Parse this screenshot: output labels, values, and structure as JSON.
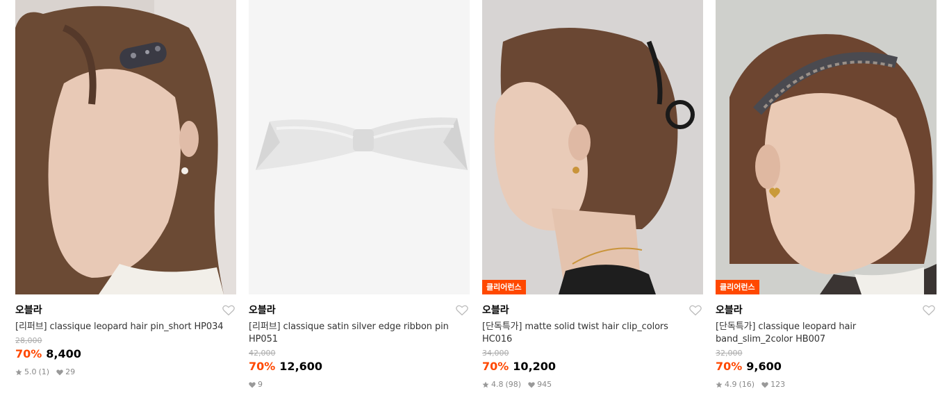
{
  "products": [
    {
      "brand": "오블라",
      "title": "[리퍼브] classique leopard hair pin_short HP034",
      "original_price": "28,000",
      "discount": "70%",
      "price": "8,400",
      "rating": "5.0",
      "review_count": "(1)",
      "likes": "29",
      "badge": null,
      "image_alt": "model wearing leopard hair pin"
    },
    {
      "brand": "오블라",
      "title": "[리퍼브] classique satin silver edge ribbon pin HP051",
      "original_price": "42,000",
      "discount": "70%",
      "price": "12,600",
      "rating": null,
      "review_count": null,
      "likes": "9",
      "badge": null,
      "image_alt": "white satin ribbon pin"
    },
    {
      "brand": "오블라",
      "title": "[단독특가] matte solid twist hair clip_colors HC016",
      "original_price": "34,000",
      "discount": "70%",
      "price": "10,200",
      "rating": "4.8",
      "review_count": "(98)",
      "likes": "945",
      "badge": "클리어런스",
      "image_alt": "model wearing black twist hair clip"
    },
    {
      "brand": "오블라",
      "title": "[단독특가] classique leopard hair band_slim_2color HB007",
      "original_price": "32,000",
      "discount": "70%",
      "price": "9,600",
      "rating": "4.9",
      "review_count": "(16)",
      "likes": "123",
      "badge": "클리어런스",
      "image_alt": "model wearing leopard hair band"
    }
  ],
  "colors": {
    "accent": "#ff4800",
    "muted": "#888888",
    "strike": "#aaaaaa"
  },
  "icons": {
    "like": "heart-outline-icon",
    "rating": "star-icon",
    "likes": "heart-filled-icon"
  }
}
